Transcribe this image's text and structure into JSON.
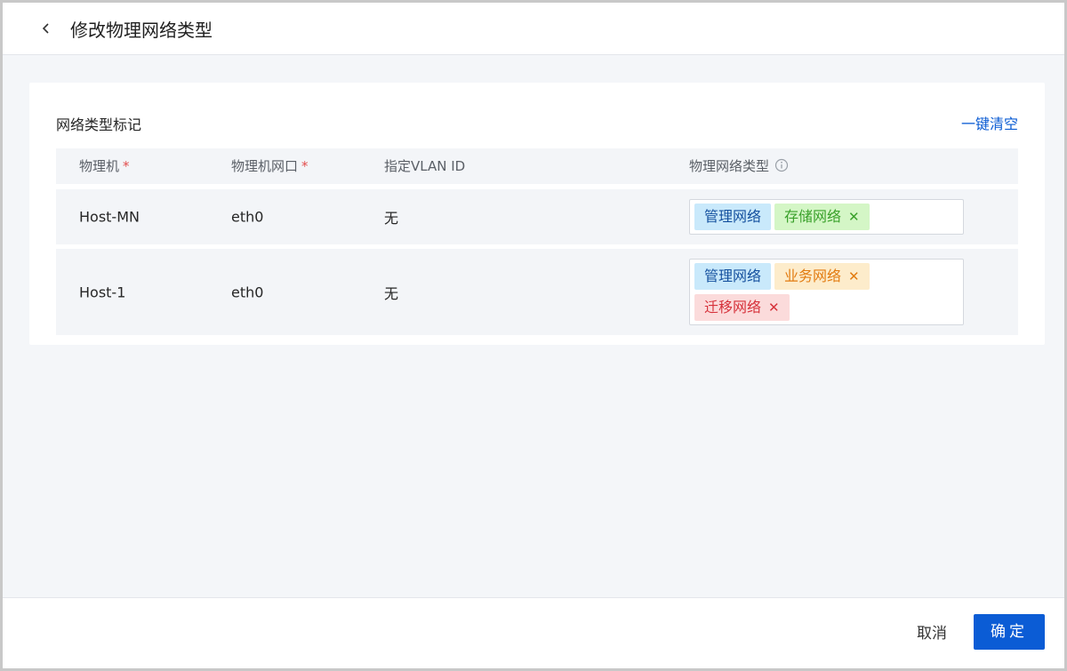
{
  "header": {
    "title": "修改物理网络类型"
  },
  "section": {
    "title": "网络类型标记",
    "clear_label": "一键清空"
  },
  "table": {
    "columns": [
      {
        "label": "物理机",
        "required": "*"
      },
      {
        "label": "物理机网口",
        "required": "*"
      },
      {
        "label": "指定VLAN ID"
      },
      {
        "label": "物理网络类型"
      }
    ],
    "rows": [
      {
        "host": "Host-MN",
        "nic": "eth0",
        "vlan": "无",
        "tags": [
          {
            "label": "管理网络",
            "color": "blue",
            "removable": false
          },
          {
            "label": "存储网络",
            "color": "green",
            "removable": true
          }
        ]
      },
      {
        "host": "Host-1",
        "nic": "eth0",
        "vlan": "无",
        "tags": [
          {
            "label": "管理网络",
            "color": "blue",
            "removable": false
          },
          {
            "label": "业务网络",
            "color": "orange",
            "removable": true
          },
          {
            "label": "迁移网络",
            "color": "red",
            "removable": true
          }
        ]
      }
    ]
  },
  "footer": {
    "cancel_label": "取消",
    "ok_label": "确定"
  },
  "colors": {
    "primary": "#0b5cd5",
    "link": "#0a5bd3",
    "required": "#e34d4d"
  }
}
